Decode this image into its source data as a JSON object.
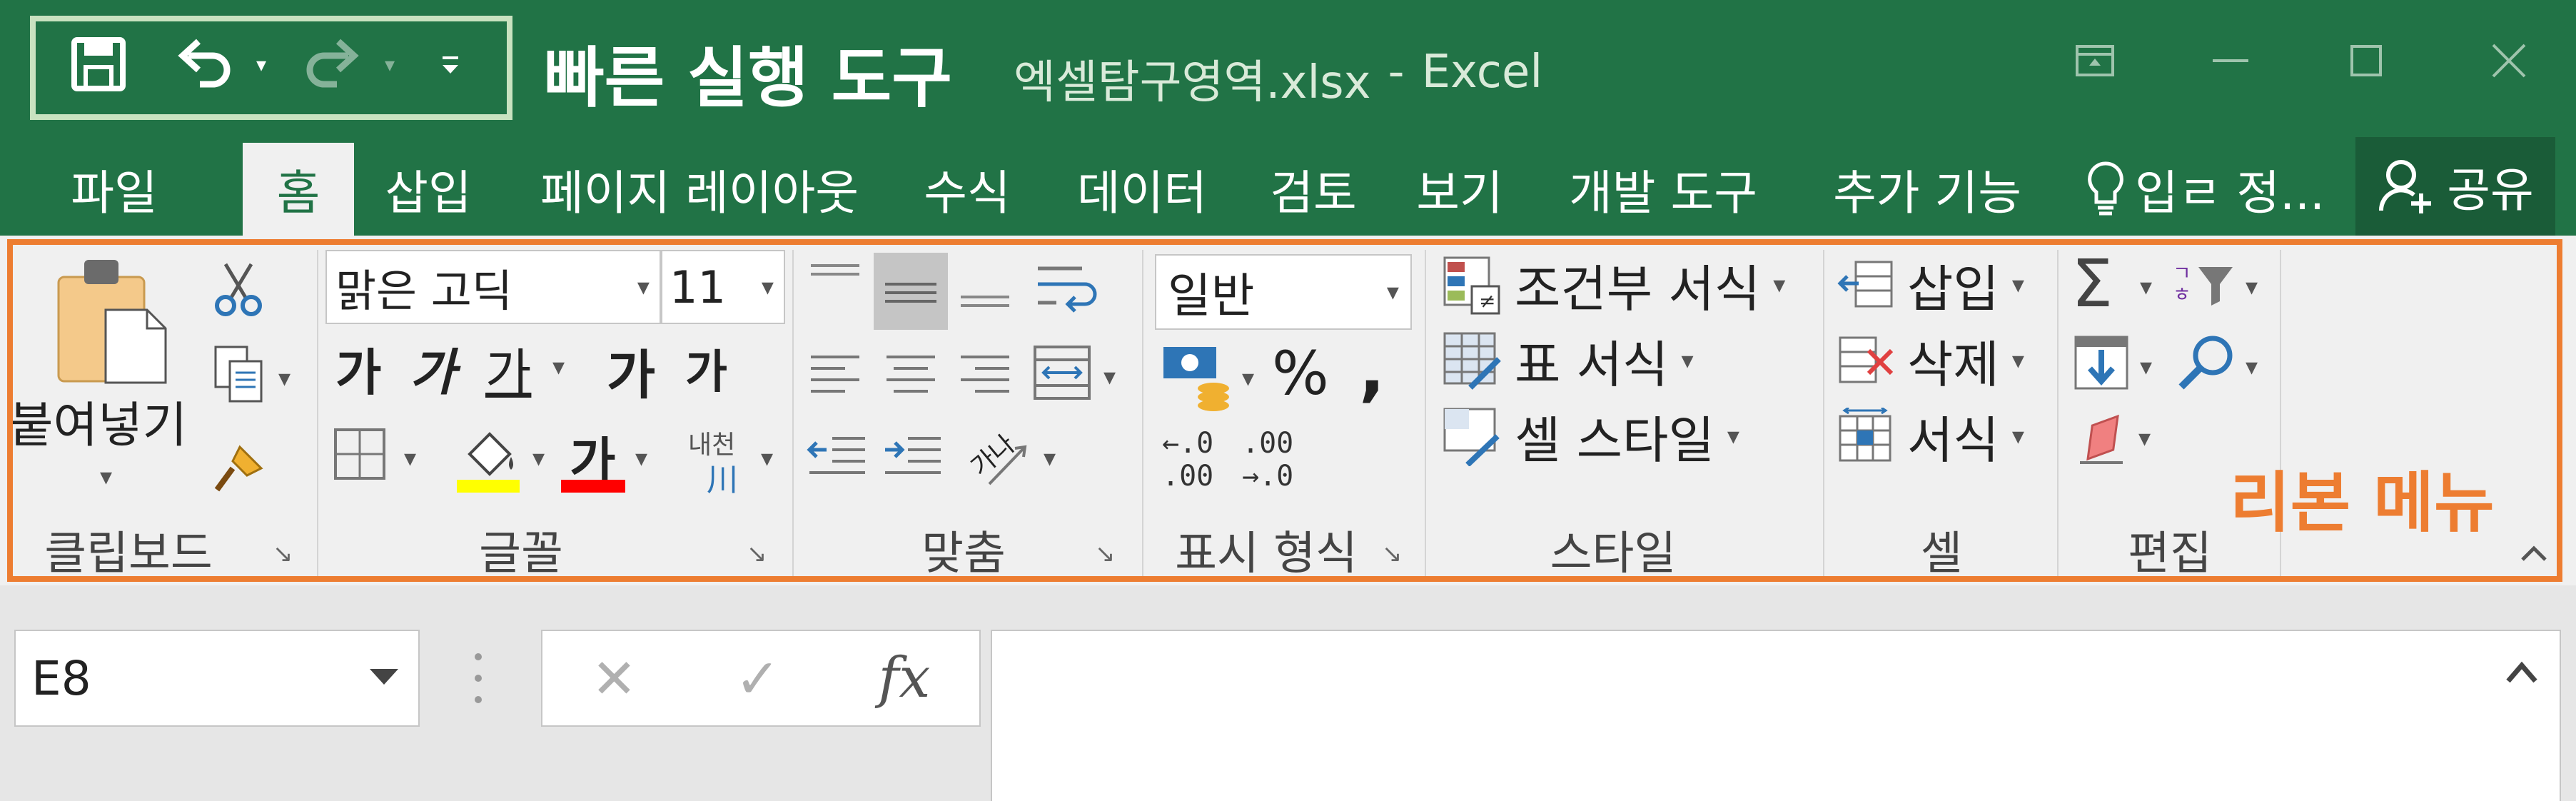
{
  "title": {
    "qat_label": "빠른 실행 도구",
    "filename": "엑셀탐구영역.xlsx",
    "separator": "-",
    "app": "Excel"
  },
  "qat_icons": [
    "save-icon",
    "undo-icon",
    "redo-icon",
    "customize-qat-icon"
  ],
  "tabs": [
    {
      "label": "파일"
    },
    {
      "label": "홈"
    },
    {
      "label": "삽입"
    },
    {
      "label": "페이지 레이아웃"
    },
    {
      "label": "수식"
    },
    {
      "label": "데이터"
    },
    {
      "label": "검토"
    },
    {
      "label": "보기"
    },
    {
      "label": "개발 도구"
    },
    {
      "label": "추가 기능"
    }
  ],
  "tell_me": "입ㄹ 정...",
  "share": "공유",
  "ribbon": {
    "annotation": "리본 메뉴",
    "clipboard": {
      "paste": "붙여넣기",
      "label": "클립보드"
    },
    "font": {
      "name": "맑은 고딕",
      "size": "11",
      "bold": "가",
      "italic": "가",
      "underline": "가",
      "grow": "가",
      "shrink": "가",
      "font_color": "가",
      "phonetic_top": "내천",
      "phonetic_bottom": "川",
      "label": "글꼴"
    },
    "alignment": {
      "orient": "가나",
      "label": "맞춤"
    },
    "number": {
      "format": "일반",
      "percent": "%",
      "comma": ",",
      "inc_top": "←.0",
      "inc_bottom": ".00",
      "dec_top": ".00",
      "dec_bottom": "→.0",
      "label": "표시 형식"
    },
    "styles": {
      "conditional": "조건부 서식",
      "table": "표 서식",
      "cell": "셀 스타일",
      "label": "스타일"
    },
    "cells": {
      "insert": "삽입",
      "delete": "삭제",
      "format": "서식",
      "label": "셀"
    },
    "editing": {
      "sum": "Σ",
      "label": "편집"
    }
  },
  "formula_bar": {
    "name_box": "E8",
    "cancel": "✕",
    "enter": "✓",
    "fx": "fx",
    "formula": ""
  },
  "colors": {
    "excel_green": "#217346",
    "highlight": "#ed7d31",
    "fill_yellow": "#ffff00",
    "font_red": "#ff0000"
  }
}
